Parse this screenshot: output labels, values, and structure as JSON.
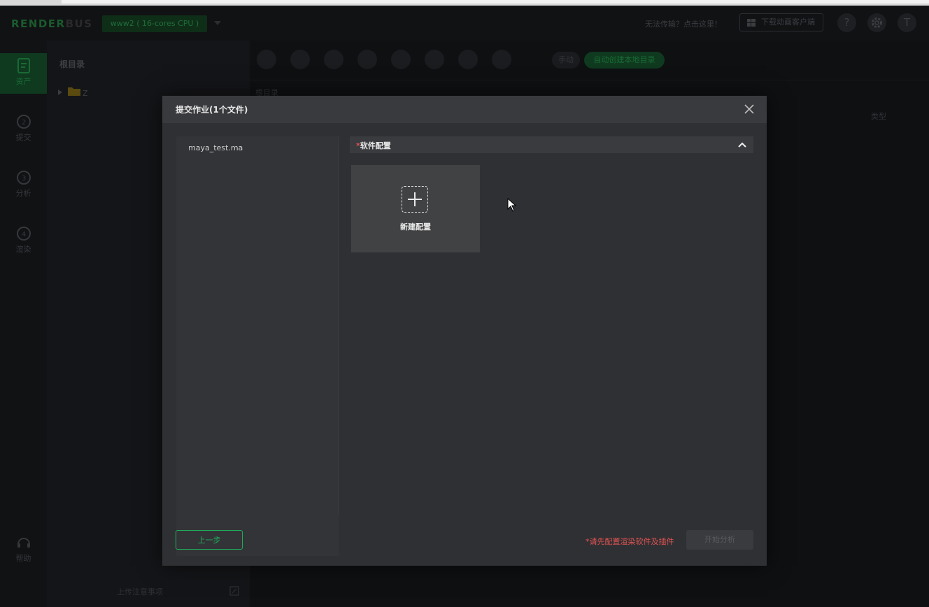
{
  "header": {
    "logo_render": "RENDER",
    "logo_bus": "BUS",
    "env_label": "www2 ( 16-cores CPU )",
    "help_link": "无法传输？点击这里！",
    "download_label": "下载动画客户端",
    "help_icon_glyph": "?",
    "user_initial": "T"
  },
  "rail": {
    "items": [
      {
        "label": "资产",
        "icon": "asset-doc-icon",
        "active": true
      },
      {
        "label": "提交",
        "icon": "submit-step2-icon",
        "active": false
      },
      {
        "label": "分析",
        "icon": "analyze-step3-icon",
        "active": false
      },
      {
        "label": "渲染",
        "icon": "render-step4-icon",
        "active": false
      }
    ],
    "help_label": "帮助"
  },
  "tree": {
    "title": "根目录",
    "folder_name": "Z",
    "upload_notes": "上传注意事项"
  },
  "main": {
    "manual_label": "手动",
    "auto_label": "自动创建本地目录",
    "path": "根目录",
    "col_type": "类型"
  },
  "modal": {
    "title": "提交作业(1个文件)",
    "file_name": "maya_test.ma",
    "section_required": "*",
    "section_label": "软件配置",
    "new_config_label": "新建配置",
    "prev_button": "上一步",
    "warning": "*请先配置渲染软件及插件",
    "start_button": "开始分析"
  },
  "colors": {
    "accent_green": "#1fae5c",
    "warning_red": "#e05353",
    "modal_bg": "#2f3033"
  }
}
